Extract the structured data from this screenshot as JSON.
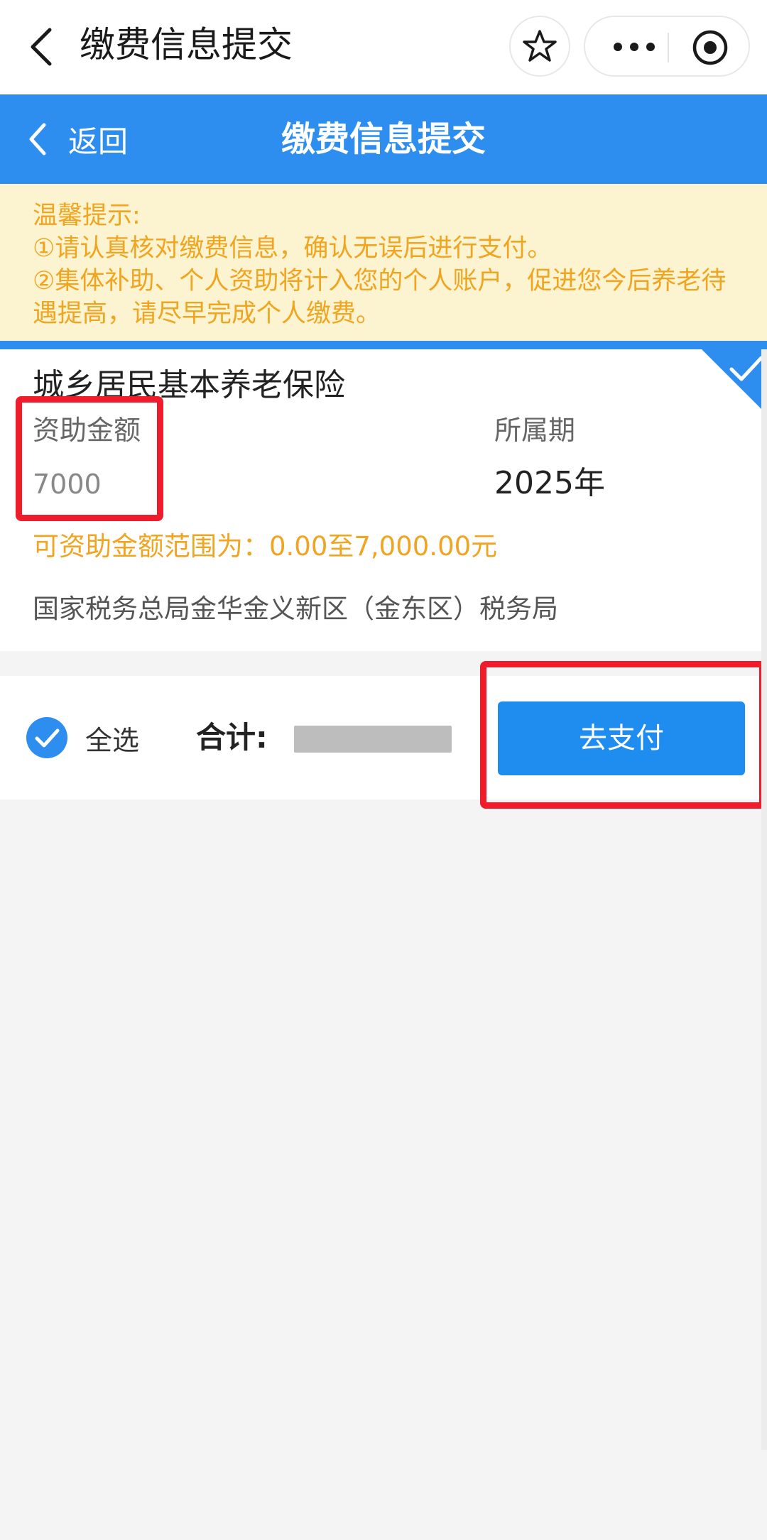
{
  "header": {
    "title": "缴费信息提交"
  },
  "navbar": {
    "back_label": "返回",
    "title": "缴费信息提交"
  },
  "tip": {
    "heading": "温馨提示:",
    "line1": "①请认真核对缴费信息，确认无误后进行支付。",
    "line2": "②集体补助、个人资助将计入您的个人账户，促进您今后养老待遇提高，请尽早完成个人缴费。"
  },
  "item": {
    "title": "城乡居民基本养老保险",
    "amount_label": "资助金额",
    "amount_value": "7000",
    "period_label": "所属期",
    "period_value": "2025年",
    "range_text": "可资助金额范围为：0.00至7,000.00元",
    "office": "国家税务总局金华金义新区（金东区）税务局",
    "selected": true
  },
  "footer": {
    "select_all_label": "全选",
    "total_label": "合计:",
    "pay_label": "去支付"
  },
  "colors": {
    "primary_blue": "#2d8ef0",
    "pay_button": "#1f8cf0",
    "tip_background": "#fcf3d0",
    "tip_text": "#f0a520",
    "highlight_red": "#ef1c2b"
  },
  "icons": {
    "header_back": "chevron-left-icon",
    "favorite": "star-icon",
    "more": "more-dots-icon",
    "close_program": "target-icon",
    "nav_back": "chevron-left-icon",
    "selected_corner": "checkmark-icon",
    "select_all": "check-circle-icon"
  }
}
